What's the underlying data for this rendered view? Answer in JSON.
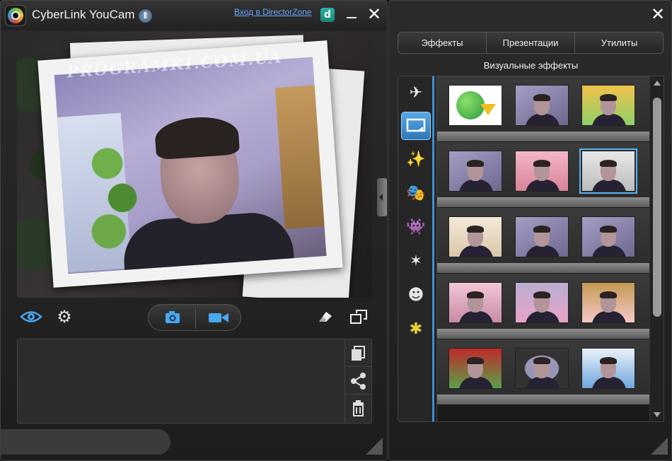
{
  "left_window": {
    "title": "CyberLink YouCam",
    "login_link": "Вход в DirectorZone",
    "directorzone_icon": "d",
    "watermark": "PROGRAMKI.COM.UA",
    "icons": {
      "app_logo": "youcam-logo-icon",
      "upgrade": "upload-arrow-icon",
      "minimize": "minimize-icon",
      "close": "close-icon",
      "eye": "eye-icon",
      "settings": "gear-icon",
      "photo": "camera-icon",
      "video": "video-camera-icon",
      "eraser": "eraser-icon",
      "fullscreen": "fullscreen-icon",
      "gallery_tools": [
        "copy-photos-icon",
        "share-icon",
        "trash-icon"
      ]
    }
  },
  "right_window": {
    "tabs": [
      "Эффекты",
      "Презентации",
      "Утилиты"
    ],
    "active_tab": "Эффекты",
    "section_title": "Визуальные эффекты",
    "categories": [
      {
        "icon": "scene-frame-icon",
        "glyph": "✈"
      },
      {
        "icon": "frame-icon",
        "glyph": "▭"
      },
      {
        "icon": "magic-wand-icon",
        "glyph": "✨"
      },
      {
        "icon": "mask-icon",
        "glyph": "🎭"
      },
      {
        "icon": "monster-icon",
        "glyph": "👾"
      },
      {
        "icon": "particle-icon",
        "glyph": "✶"
      },
      {
        "icon": "emoticon-icon",
        "glyph": "☻"
      },
      {
        "icon": "star-sticker-icon",
        "glyph": "✱"
      }
    ],
    "active_category": 1,
    "accent": "#3d8fd1"
  }
}
